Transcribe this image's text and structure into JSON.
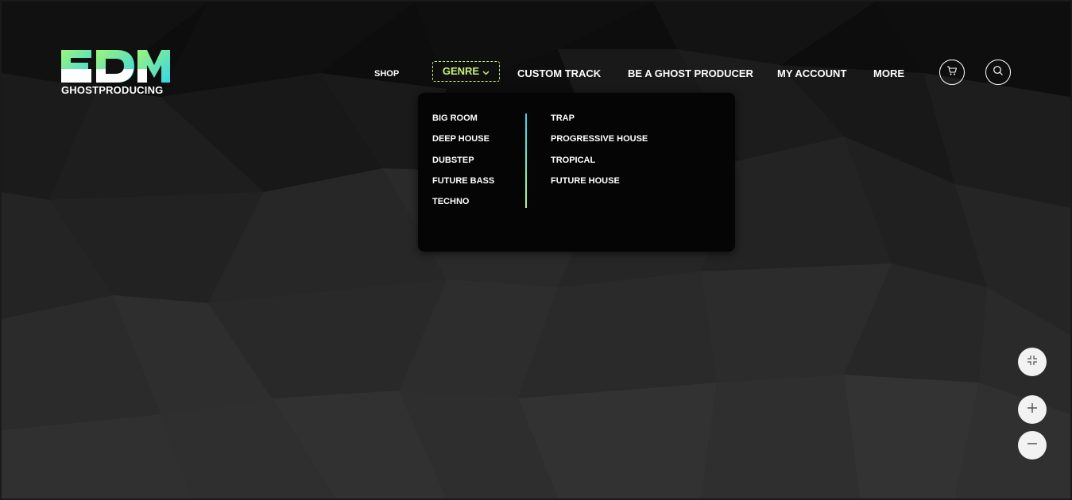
{
  "logo": {
    "letters": "EDM",
    "subtitle": "GHOSTPRODUCING",
    "gradient_start": "#9ff47a",
    "gradient_end": "#33d6e8"
  },
  "nav": {
    "shop": "SHOP",
    "genre": "GENRE",
    "custom_track": "CUSTOM TRACK",
    "ghost_producer": "BE A GHOST PRODUCER",
    "my_account": "MY ACCOUNT",
    "more": "MORE",
    "active_color": "#c8f27a"
  },
  "icons": {
    "cart": "cart-icon",
    "search": "search-icon",
    "genre_chevron": "chevron-down-icon",
    "fit": "collapse-icon",
    "zoom_in": "plus-icon",
    "zoom_out": "minus-icon"
  },
  "genre_menu": {
    "left_column": [
      "BIG ROOM",
      "DEEP HOUSE",
      "DUBSTEP",
      "FUTURE BASS",
      "TECHNO"
    ],
    "right_column": [
      "TRAP",
      "PROGRESSIVE HOUSE",
      "TROPICAL",
      "FUTURE HOUSE"
    ],
    "divider_gradient": [
      "#3ad6f0",
      "#b6f58a"
    ]
  }
}
